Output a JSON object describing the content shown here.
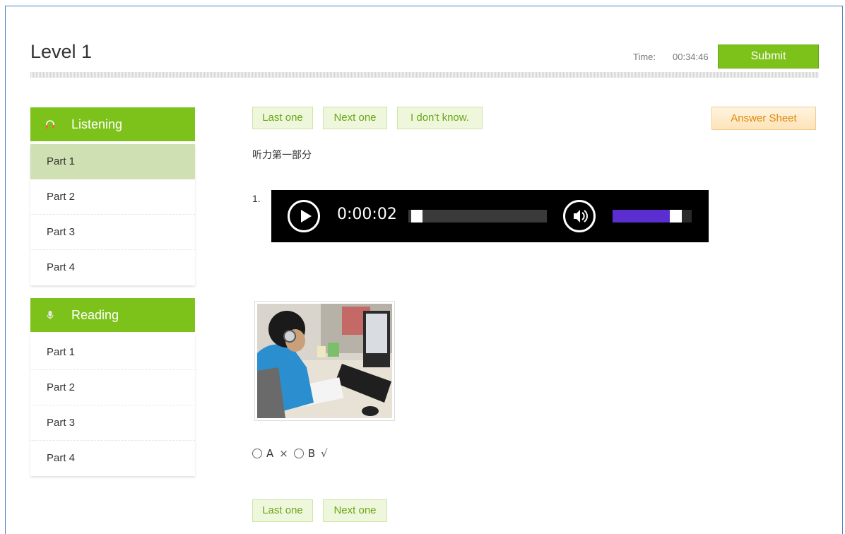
{
  "header": {
    "title": "Level 1",
    "time_label": "Time:",
    "time_value": "00:34:46",
    "submit_label": "Submit"
  },
  "sidebar": {
    "listening": {
      "label": "Listening",
      "icon": "headphones-icon",
      "parts": [
        "Part 1",
        "Part 2",
        "Part 3",
        "Part 4"
      ],
      "active_index": 0
    },
    "reading": {
      "label": "Reading",
      "icon": "microphone-icon",
      "parts": [
        "Part 1",
        "Part 2",
        "Part 3",
        "Part 4"
      ]
    }
  },
  "toolbar": {
    "last_label": "Last one",
    "next_label": "Next one",
    "dont_know_label": "I don't know.",
    "answer_sheet_label": "Answer Sheet"
  },
  "question": {
    "section_title": "听力第一部分",
    "number": "1.",
    "audio": {
      "elapsed": "0:00:02",
      "progress": 0.02,
      "volume": 0.85
    },
    "options": [
      {
        "label": "A",
        "mark": "×"
      },
      {
        "label": "B",
        "mark": "√"
      }
    ]
  },
  "footer_nav": {
    "last_label": "Last one",
    "next_label": "Next one"
  },
  "colors": {
    "accent": "#7cc21a",
    "active_item": "#cfe0b3",
    "answer_sheet": "#e0890b",
    "volume_fill": "#5a2ecf"
  }
}
